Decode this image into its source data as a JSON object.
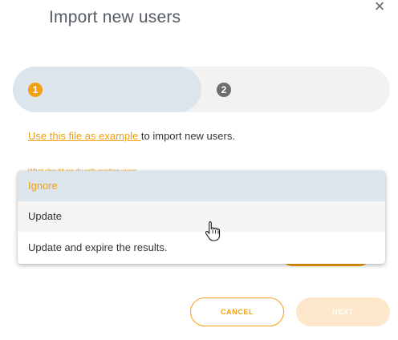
{
  "dialog": {
    "title": "Import new users",
    "close_icon": "close-icon"
  },
  "stepper": {
    "steps": [
      {
        "number": "1",
        "active": true
      },
      {
        "number": "2",
        "active": false
      }
    ]
  },
  "example": {
    "link_text": "Use this file as example ",
    "rest_text": "to import new users."
  },
  "behind": {
    "label": "What should we do with existing users"
  },
  "dropdown": {
    "options": [
      {
        "label": "Ignore",
        "state": "selected"
      },
      {
        "label": "Update",
        "state": "hover"
      },
      {
        "label": "Update and expire the results.",
        "state": "normal"
      }
    ]
  },
  "buttons": {
    "cancel": "CANCEL",
    "next": "NEXT"
  },
  "colors": {
    "accent": "#f0a010",
    "selected_bg": "#dde5ec",
    "next_disabled_bg": "#fde8cc"
  }
}
